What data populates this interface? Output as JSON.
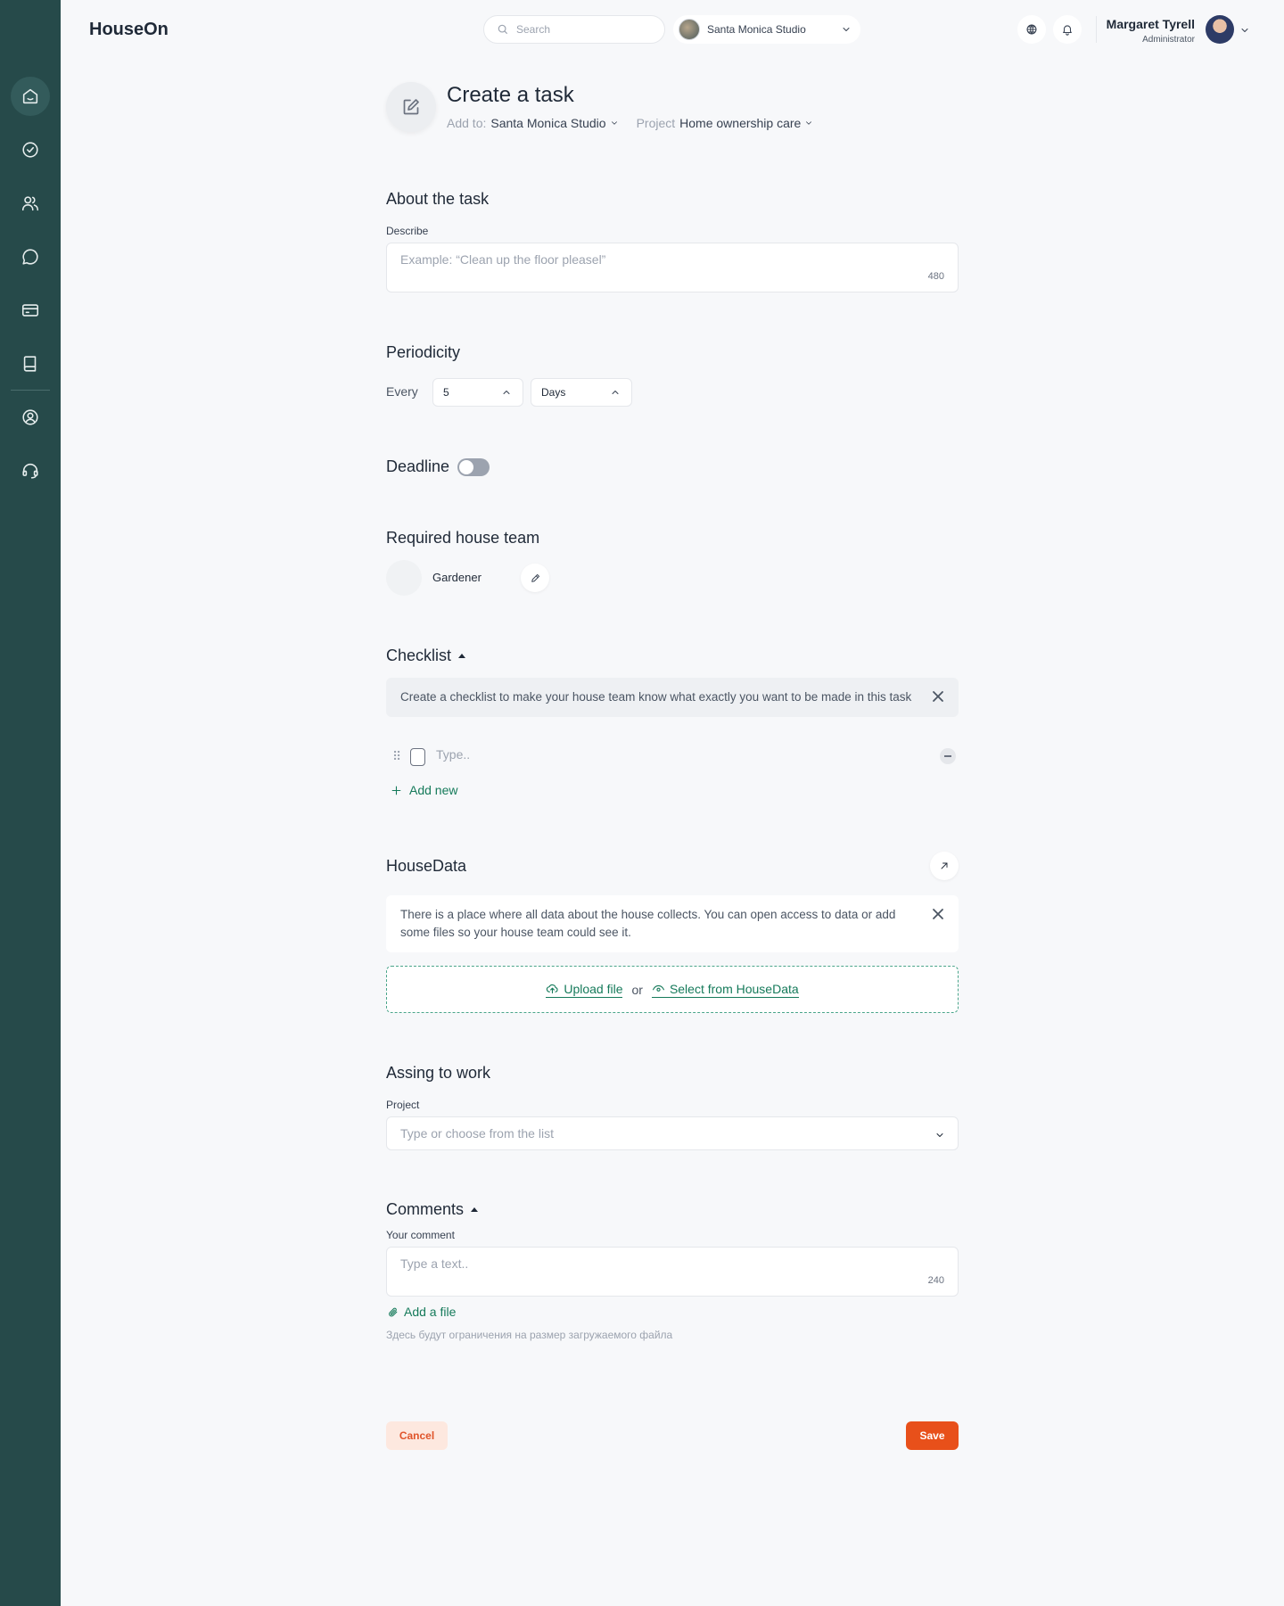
{
  "app": {
    "name": "HouseOn"
  },
  "sidebar": {
    "items": [
      {
        "icon": "home-icon",
        "active": true
      },
      {
        "icon": "check-circle-icon",
        "active": false
      },
      {
        "icon": "users-icon",
        "active": false
      },
      {
        "icon": "chat-icon",
        "active": false
      },
      {
        "icon": "card-icon",
        "active": false
      },
      {
        "icon": "book-icon",
        "active": false
      },
      {
        "icon": "profile-icon",
        "active": false
      },
      {
        "icon": "support-icon",
        "active": false
      }
    ]
  },
  "header": {
    "search_placeholder": "Search",
    "studio": "Santa Monica Studio",
    "user_name": "Margaret Tyrell",
    "user_role": "Administrator"
  },
  "task": {
    "title": "Create a task",
    "add_to_label": "Add to:",
    "add_to_value": "Santa Monica Studio",
    "project_label": "Project",
    "project_value": "Home ownership care"
  },
  "about": {
    "title": "About the task",
    "describe_label": "Describe",
    "describe_placeholder": "Example: “Clean up the floor pleasel”",
    "counter": "480"
  },
  "periodicity": {
    "title": "Periodicity",
    "every_label": "Every",
    "count": "5",
    "unit": "Days"
  },
  "deadline": {
    "title": "Deadline",
    "enabled": false
  },
  "team": {
    "title": "Required house team",
    "member": "Gardener"
  },
  "checklist": {
    "title": "Checklist",
    "info": "Create a checklist to make your house team know what exactly you want to be made in this task",
    "item_placeholder": "Type..",
    "add_new": "Add new"
  },
  "housedata": {
    "title": "HouseData",
    "info": "There is a place where all data about the house  collects. You can open access to data or add some files so your house team could see it.",
    "upload": "Upload file",
    "or": "or",
    "select": "Select from HouseData"
  },
  "assign": {
    "title": "Assing to work",
    "project_label": "Project",
    "project_placeholder": "Type or choose from the list"
  },
  "comments": {
    "title": "Comments",
    "your_comment_label": "Your comment",
    "placeholder": "Type a text..",
    "counter": "240",
    "add_file": "Add a file",
    "hint": "Здесь будут ограничения на размер загружаемого файла"
  },
  "actions": {
    "cancel": "Cancel",
    "save": "Save"
  },
  "colors": {
    "sidebar": "#264a4a",
    "accent_green": "#157a5a",
    "accent_orange": "#e8501a",
    "background": "#f7f8fa"
  }
}
